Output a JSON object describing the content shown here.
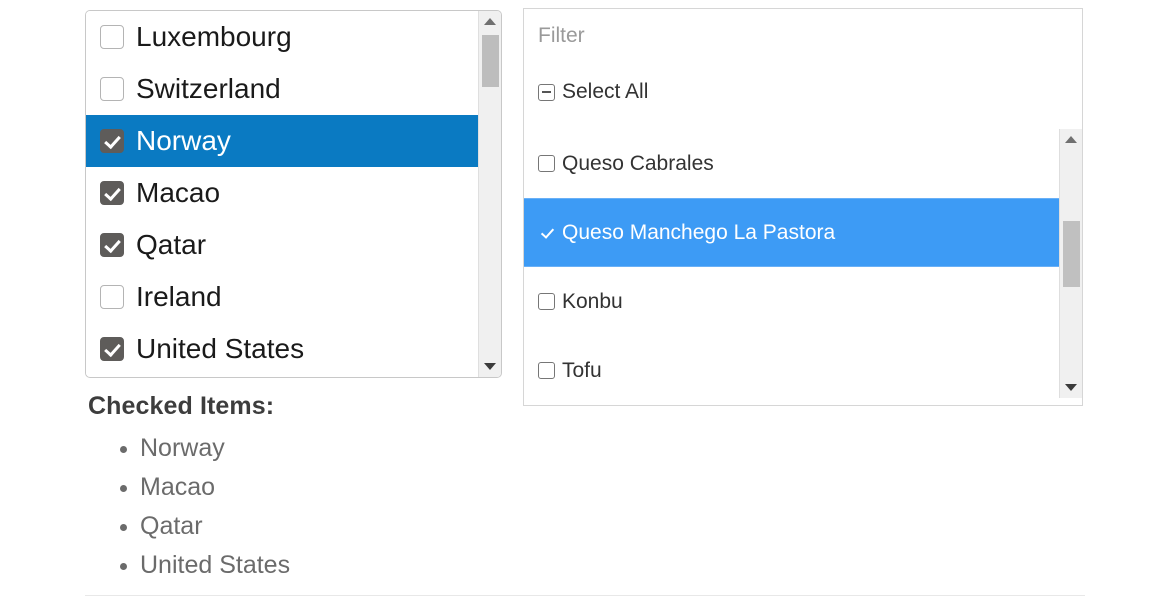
{
  "left_panel": {
    "name": "country-checkbox-list",
    "items": [
      {
        "label": "Luxembourg",
        "checked": false,
        "selected": false
      },
      {
        "label": "Switzerland",
        "checked": false,
        "selected": false
      },
      {
        "label": "Norway",
        "checked": true,
        "selected": true
      },
      {
        "label": "Macao",
        "checked": true,
        "selected": false
      },
      {
        "label": "Qatar",
        "checked": true,
        "selected": false
      },
      {
        "label": "Ireland",
        "checked": false,
        "selected": false
      },
      {
        "label": "United States",
        "checked": true,
        "selected": false
      }
    ],
    "scrollbar": {
      "up_arrow_icon": "triangle-up-icon",
      "down_arrow_icon": "triangle-down-icon"
    },
    "colors": {
      "selected_background": "#0a7ac2",
      "checkbox_checked": "#5e5c5a",
      "border": "#c8c8c8"
    }
  },
  "right_panel": {
    "name": "product-filter-list",
    "filter": {
      "placeholder": "Filter",
      "value": ""
    },
    "select_all": {
      "label": "Select All",
      "state": "indeterminate",
      "icon": "checkbox-indeterminate-icon"
    },
    "items": [
      {
        "label": "Queso Cabrales",
        "checked": false,
        "selected": false
      },
      {
        "label": "Queso Manchego La Pastora",
        "checked": true,
        "selected": true
      },
      {
        "label": "Konbu",
        "checked": false,
        "selected": false
      },
      {
        "label": "Tofu",
        "checked": false,
        "selected": false
      }
    ],
    "scrollbar": {
      "up_arrow_icon": "triangle-up-icon",
      "down_arrow_icon": "triangle-down-icon"
    },
    "colors": {
      "selected_background": "#3d9bf5",
      "placeholder_text": "#9a9a9a",
      "border": "#d6d6d6"
    }
  },
  "checked_items": {
    "heading": "Checked Items:",
    "items": [
      "Norway",
      "Macao",
      "Qatar",
      "United States"
    ]
  }
}
